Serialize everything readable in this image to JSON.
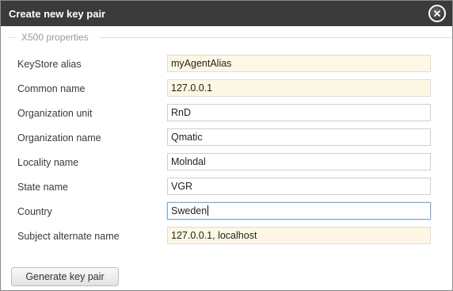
{
  "dialog": {
    "title": "Create new key pair",
    "close_icon": "close-icon"
  },
  "fieldset": {
    "legend": "X500 properties"
  },
  "fields": [
    {
      "label": "KeyStore alias",
      "value": "myAgentAlias",
      "readonly": true
    },
    {
      "label": "Common name",
      "value": "127.0.0.1",
      "readonly": true
    },
    {
      "label": "Organization unit",
      "value": "RnD",
      "readonly": false
    },
    {
      "label": "Organization name",
      "value": "Qmatic",
      "readonly": false
    },
    {
      "label": "Locality name",
      "value": "Molndal",
      "readonly": false
    },
    {
      "label": "State name",
      "value": "VGR",
      "readonly": false
    },
    {
      "label": "Country",
      "value": "Sweden",
      "readonly": false,
      "focused": true
    },
    {
      "label": "Subject alternate name",
      "value": "127.0.0.1, localhost",
      "readonly": true
    }
  ],
  "actions": {
    "generate_label": "Generate key pair"
  },
  "colors": {
    "titlebar": "#3b3b3b",
    "readonly_bg": "#fdf7e3",
    "focus_border": "#7fa8d6"
  }
}
